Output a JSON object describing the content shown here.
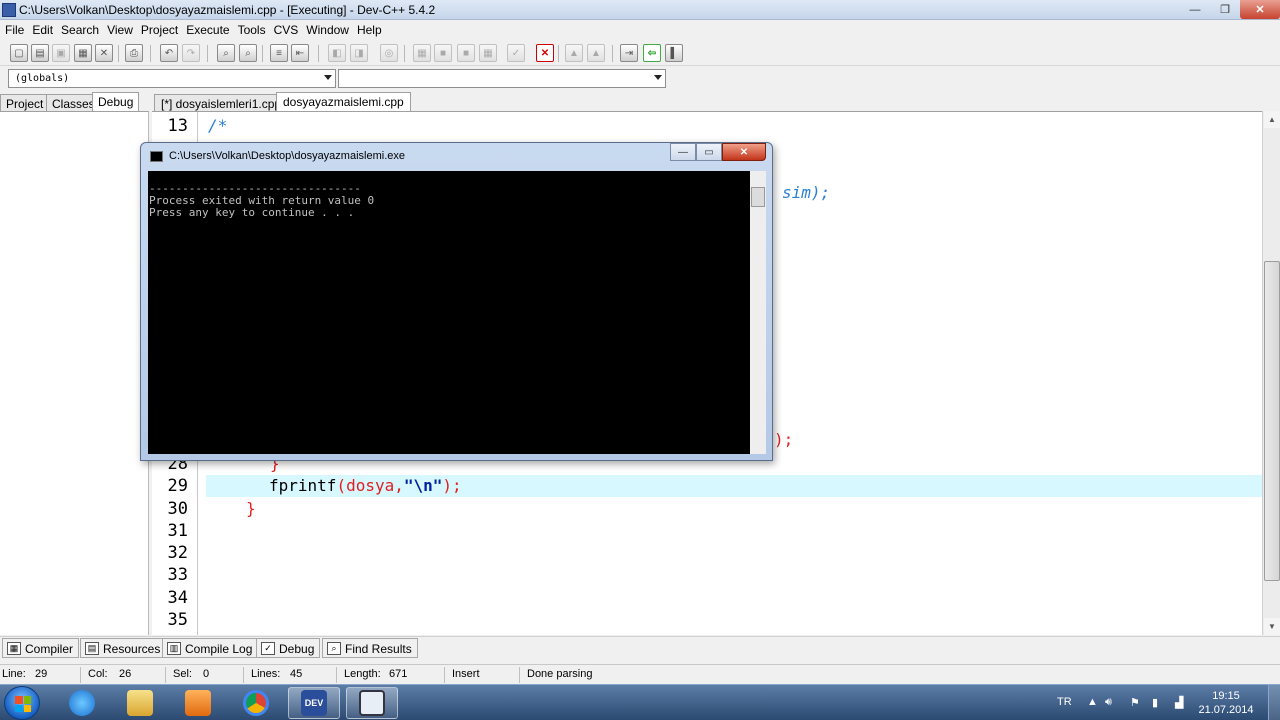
{
  "window": {
    "title": "C:\\Users\\Volkan\\Desktop\\dosyayazmaislemi.cpp - [Executing] - Dev-C++ 5.4.2",
    "min": "—",
    "max": "❐",
    "close": "✕"
  },
  "menu": [
    "File",
    "Edit",
    "Search",
    "View",
    "Project",
    "Execute",
    "Tools",
    "CVS",
    "Window",
    "Help"
  ],
  "combos": {
    "scope": "(globals)",
    "member": ""
  },
  "left_tabs": [
    "Project",
    "Classes",
    "Debug"
  ],
  "left_tab_active": "Debug",
  "editor_tabs": [
    "[*] dosyaislemleri1.cpp",
    "dosyayazmaislemi.cpp"
  ],
  "editor_tab_active": "dosyayazmaislemi.cpp",
  "editor": {
    "line_numbers": [
      "13",
      "28",
      "29",
      "30",
      "31",
      "32",
      "33",
      "34",
      "35"
    ],
    "line13_code": "/*",
    "visible_right_fragment": "sim);",
    "visible_right_fragment2": ");",
    "line28_code": "}",
    "line29_func": "fprintf",
    "line29_open": "(dosya,",
    "line29_str": "\"\\n\"",
    "line29_close": ");",
    "line30_code": "}"
  },
  "console": {
    "title": "C:\\Users\\Volkan\\Desktop\\dosyayazmaislemi.exe",
    "lines": [
      "--------------------------------",
      "Process exited with return value 0",
      "Press any key to continue . . ."
    ],
    "min": "—",
    "max": "▭",
    "close": "✕"
  },
  "message_tabs": [
    {
      "label": "Compiler",
      "icon": "compiler-icon"
    },
    {
      "label": "Resources",
      "icon": "resources-icon"
    },
    {
      "label": "Compile Log",
      "icon": "compile-log-icon"
    },
    {
      "label": "Debug",
      "icon": "debug-icon"
    },
    {
      "label": "Find Results",
      "icon": "find-results-icon"
    }
  ],
  "status": {
    "line_label": "Line:",
    "line_value": "29",
    "col_label": "Col:",
    "col_value": "26",
    "sel_label": "Sel:",
    "sel_value": "0",
    "lines_label": "Lines:",
    "lines_value": "45",
    "length_label": "Length:",
    "length_value": "671",
    "mode": "Insert",
    "message": "Done parsing"
  },
  "taskbar": {
    "lang": "TR",
    "time": "19:15",
    "date": "21.07.2014",
    "apps": [
      "internet-explorer-icon",
      "file-explorer-icon",
      "media-player-icon",
      "chrome-icon",
      "dev-cpp-icon",
      "console-icon"
    ],
    "devcpp_label": "DEV"
  },
  "colors": {
    "comment": "#2a7fd4",
    "brace": "#e02020",
    "current_line": "#d8f8ff",
    "taskbar": "#2c4a72"
  }
}
